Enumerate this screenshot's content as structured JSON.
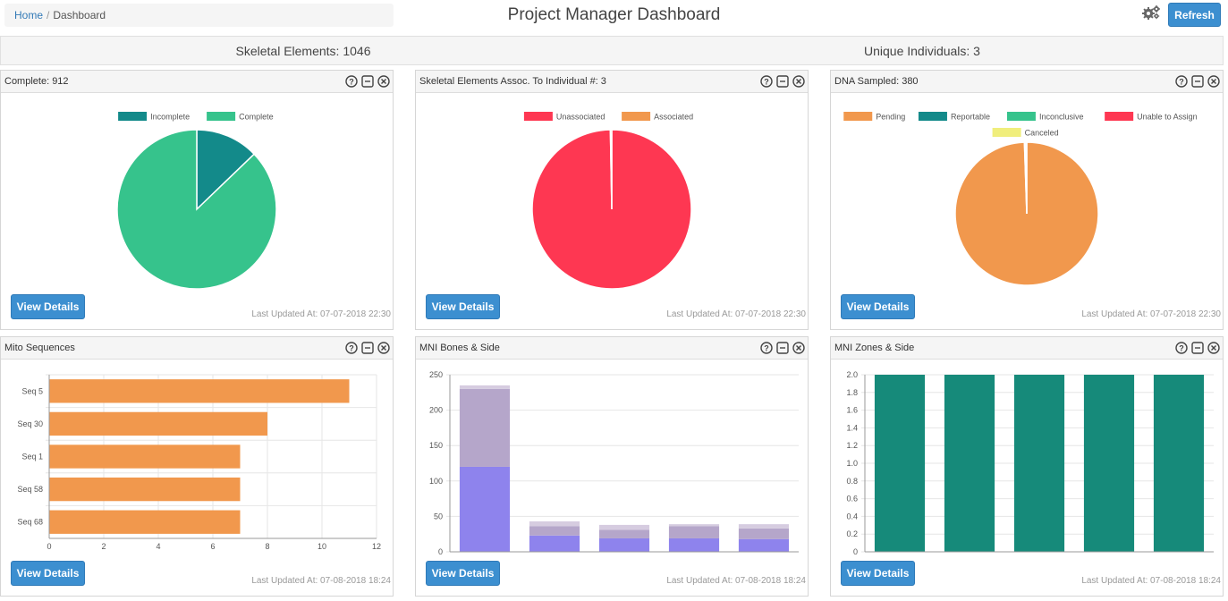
{
  "header": {
    "breadcrumb": {
      "home": "Home",
      "separator": "/",
      "current": "Dashboard"
    },
    "title": "Project Manager Dashboard",
    "gear_icon": "cogs-icon",
    "refresh_label": "Refresh"
  },
  "stats": {
    "skeletal": "Skeletal Elements: 1046",
    "unique": "Unique Individuals: 3"
  },
  "colors": {
    "teal": "#138a8a",
    "green": "#36c38c",
    "red": "#fe3752",
    "orange": "#f1984d",
    "yellow": "#f0ee7c",
    "purple_dark": "#8e83ed",
    "purple_mid": "#b5a6ca",
    "purple_light": "#d6cce0",
    "mni_teal": "#168a7a",
    "button": "#3c8fd0"
  },
  "panel_icons": [
    "help-icon",
    "minimize-icon",
    "close-icon"
  ],
  "panels": [
    {
      "title": "Complete: 912",
      "button": "View Details",
      "updated": "Last Updated At: 07-07-2018 22:30",
      "chart_data": {
        "type": "pie",
        "legend": [
          "Incomplete",
          "Complete"
        ],
        "legend_rows": [
          [
            "Incomplete",
            "Complete"
          ]
        ],
        "labels": [
          "Incomplete",
          "Complete"
        ],
        "values": [
          134,
          912
        ],
        "colors": [
          "#138a8a",
          "#36c38c"
        ]
      }
    },
    {
      "title": "Skeletal Elements Assoc. To Individual #: 3",
      "button": "View Details",
      "updated": "Last Updated At: 07-07-2018 22:30",
      "chart_data": {
        "type": "pie",
        "legend": [
          "Unassociated",
          "Associated"
        ],
        "legend_rows": [
          [
            "Unassociated",
            "Associated"
          ]
        ],
        "labels": [
          "Unassociated",
          "Associated"
        ],
        "values": [
          1043,
          3
        ],
        "colors": [
          "#fe3752",
          "#f1984d"
        ]
      }
    },
    {
      "title": "DNA Sampled: 380",
      "button": "View Details",
      "updated": "Last Updated At: 07-07-2018 22:30",
      "chart_data": {
        "type": "pie",
        "legend": [
          "Pending",
          "Reportable",
          "Inconclusive",
          "Unable to Assign",
          "Canceled"
        ],
        "legend_rows": [
          [
            "Pending",
            "Reportable",
            "Inconclusive",
            "Unable to Assign"
          ],
          [
            "Canceled"
          ]
        ],
        "labels": [
          "Pending",
          "Reportable",
          "Inconclusive",
          "Unable to Assign",
          "Canceled"
        ],
        "values": [
          378,
          1,
          0,
          0,
          1
        ],
        "colors": [
          "#f1984d",
          "#138a8a",
          "#36c38c",
          "#fe3752",
          "#f0ee7c"
        ]
      }
    },
    {
      "title": "Mito Sequences",
      "button": "View Details",
      "updated": "Last Updated At: 07-08-2018 18:24",
      "chart_data": {
        "type": "bar",
        "orientation": "horizontal",
        "categories": [
          "Seq 5",
          "Seq 30",
          "Seq 1",
          "Seq 58",
          "Seq 68"
        ],
        "values": [
          11,
          8,
          7,
          7,
          7
        ],
        "xlim": [
          0,
          12
        ],
        "xticks": [
          0,
          2,
          4,
          6,
          8,
          10,
          12
        ],
        "color": "#f1984d",
        "grid": true
      }
    },
    {
      "title": "MNI Bones & Side",
      "button": "View Details",
      "updated": "Last Updated At: 07-08-2018 18:24",
      "chart_data": {
        "type": "bar",
        "stacked": true,
        "categories": [
          "",
          "",
          "",
          "",
          ""
        ],
        "series": [
          {
            "values": [
              120,
              23,
              19,
              19,
              18
            ],
            "color": "#8e83ed"
          },
          {
            "values": [
              110,
              13,
              12,
              17,
              15
            ],
            "color": "#b5a6ca"
          },
          {
            "values": [
              5,
              7,
              7,
              3,
              6
            ],
            "color": "#d6cce0"
          }
        ],
        "ylim": [
          0,
          250
        ],
        "yticks": [
          0,
          50,
          100,
          150,
          200,
          250
        ],
        "grid": true
      }
    },
    {
      "title": "MNI Zones & Side",
      "button": "View Details",
      "updated": "Last Updated At: 07-08-2018 18:24",
      "chart_data": {
        "type": "bar",
        "categories": [
          "",
          "",
          "",
          "",
          ""
        ],
        "values": [
          2,
          2,
          2,
          2,
          2
        ],
        "ylim": [
          0,
          2
        ],
        "yticks": [
          0,
          0.2,
          0.4,
          0.6,
          0.8,
          1.0,
          1.2,
          1.4,
          1.6,
          1.8,
          2.0
        ],
        "ytick_labels": [
          "0",
          "0.2",
          "0.4",
          "0.6",
          "0.8",
          "1.0",
          "1.2",
          "1.4",
          "1.6",
          "1.8",
          "2.0"
        ],
        "color": "#168a7a",
        "grid": true
      }
    }
  ]
}
